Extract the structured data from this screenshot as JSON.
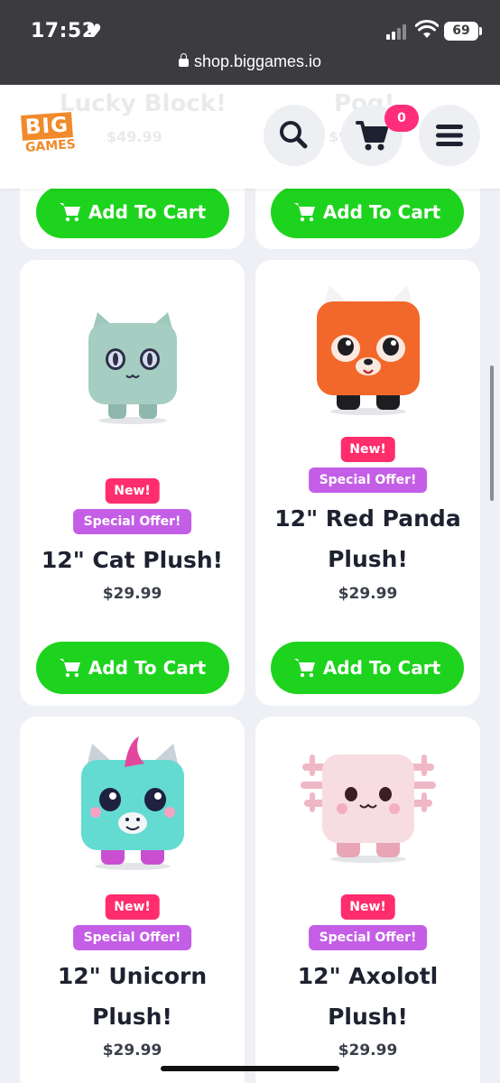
{
  "status_bar": {
    "time": "17:52",
    "battery": "69"
  },
  "browser": {
    "url": "shop.biggames.io"
  },
  "header": {
    "logo_top": "BIG",
    "logo_bottom": "GAMES",
    "cart_count": "0",
    "ghost_titles": [
      "Lucky Block!",
      "Pog!"
    ],
    "ghost_prices": [
      "$49.99",
      "$9"
    ]
  },
  "products": [
    {
      "badge_new": "New!",
      "badge_offer": "Special Offer!",
      "title_line1": "12\" Cat Plush!",
      "title_line2": "",
      "price": "$29.99",
      "button": "Add To Cart"
    },
    {
      "badge_new": "New!",
      "badge_offer": "Special Offer!",
      "title_line1": "12\" Red Panda",
      "title_line2": "Plush!",
      "price": "$29.99",
      "button": "Add To Cart"
    },
    {
      "badge_new": "New!",
      "badge_offer": "Special Offer!",
      "title_line1": "12\" Unicorn",
      "title_line2": "Plush!",
      "price": "$29.99",
      "button": "Add To Cart"
    },
    {
      "badge_new": "New!",
      "badge_offer": "Special Offer!",
      "title_line1": "12\" Axolotl",
      "title_line2": "Plush!",
      "price": "$29.99",
      "button": "Add To Cart"
    }
  ],
  "top_row_buttons": [
    "Add To Cart",
    "Add To Cart"
  ],
  "colors": {
    "cart_green": "#1ed31e",
    "badge_new": "#ff2d6c",
    "badge_offer": "#c45ee6",
    "cart_badge": "#ff2d7a",
    "brand_orange": "#f08a2a"
  }
}
